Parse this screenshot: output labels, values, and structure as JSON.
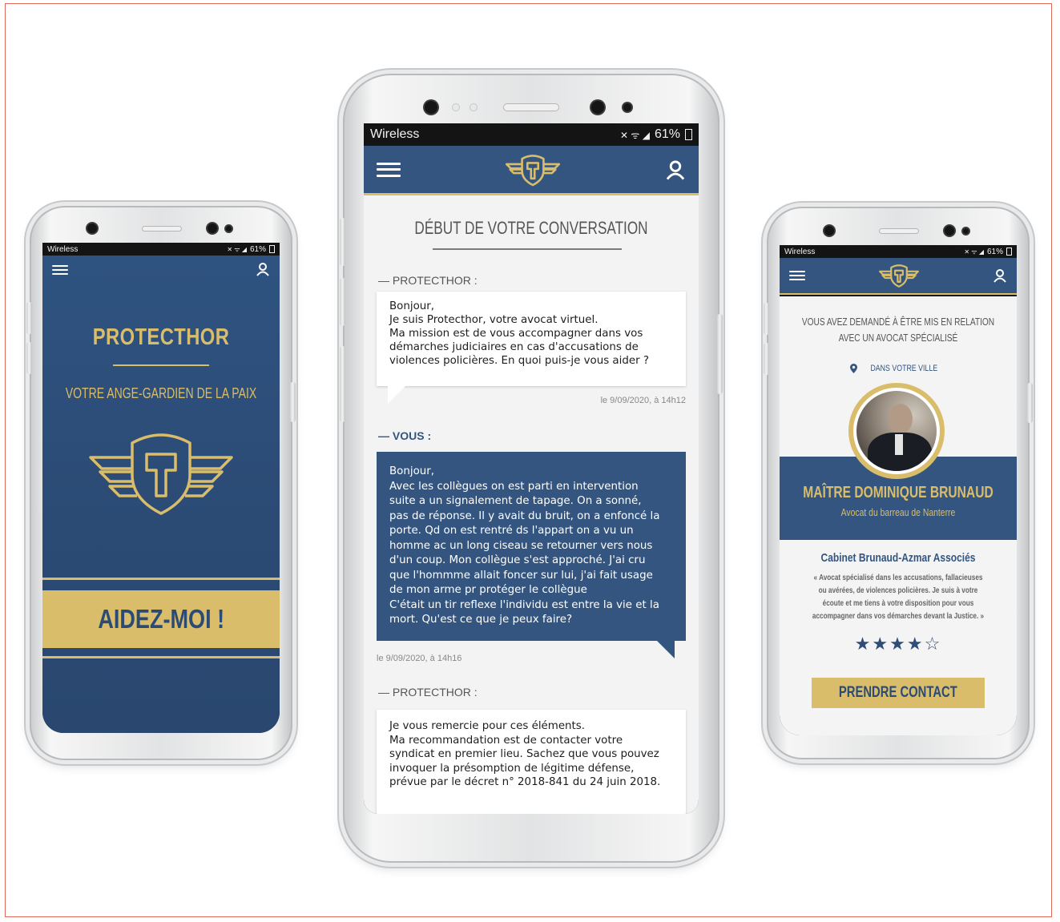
{
  "status_bar": {
    "carrier": "Wireless",
    "battery": "61%",
    "signal_glyphs": "✕ ᯤ ◢"
  },
  "left_screen": {
    "app_name": "PROTECTHOR",
    "tagline": "VOTRE ANGE-GARDIEN DE LA PAIX",
    "help_button": "AIDEZ-MOI !"
  },
  "middle_screen": {
    "title": "DÉBUT DE VOTRE CONVERSATION",
    "messages": [
      {
        "sender": "— PROTECTHOR :",
        "lines": [
          "Bonjour,",
          "Je suis Protecthor, votre avocat virtuel.",
          "Ma mission est de vous accompagner dans vos",
          "démarches judiciaires en cas d'accusations de",
          "violences policières. En quoi puis-je vous aider ?"
        ],
        "timestamp": "le 9/09/2020, à 14h12"
      },
      {
        "sender": "— VOUS :",
        "lines": [
          "Bonjour,",
          "Avec les collègues on est parti en intervention",
          "suite a un signalement de tapage. On a sonné,",
          "pas de réponse. Il y avait du bruit, on a enfoncé la",
          "porte. Qd on est rentré ds l'appart on a vu un",
          "homme ac un long ciseau se retourner vers nous",
          "d'un coup. Mon collègue s'est approché. J'ai cru",
          "que l'hommme  allait foncer sur lui, j'ai fait usage",
          "de mon arme pr protéger le collègue",
          "C'était un tir reflexe l'individu est entre la vie et la",
          "mort. Qu'est ce que je peux faire?"
        ],
        "timestamp": "le 9/09/2020, à 14h16"
      },
      {
        "sender": "— PROTECTHOR :",
        "lines": [
          "Je vous remercie pour ces éléments.",
          "Ma recommandation est de contacter votre",
          "syndicat en premier lieu. Sachez que vous pouvez",
          "invoquer la présomption de légitime défense,",
          "prévue par le décret n° 2018-841 du 24 juin 2018."
        ]
      }
    ]
  },
  "right_screen": {
    "request_text_1": "VOUS AVEZ DEMANDÉ À ÊTRE MIS EN RELATION",
    "request_text_2": "AVEC UN AVOCAT SPÉCIALISÉ",
    "location": "DANS VOTRE VILLE",
    "lawyer_name": "MAÎTRE DOMINIQUE BRUNAUD",
    "lawyer_title": "Avocat du barreau de Nanterre",
    "firm": "Cabinet Brunaud-Azmar Associés",
    "quote_lines": [
      "« Avocat spécialisé dans les accusations, fallacieuses",
      "ou avérées, de violences policières. Je suis à votre",
      "écoute et me tiens à votre disposition pour vous",
      "accompagner dans vos démarches devant la Justice. »"
    ],
    "rating": 4,
    "rating_max": 5,
    "contact_button": "PRENDRE CONTACT"
  },
  "colors": {
    "navy": "#33557f",
    "gold": "#d9bd6b",
    "light_bg": "#f3f3f3"
  }
}
